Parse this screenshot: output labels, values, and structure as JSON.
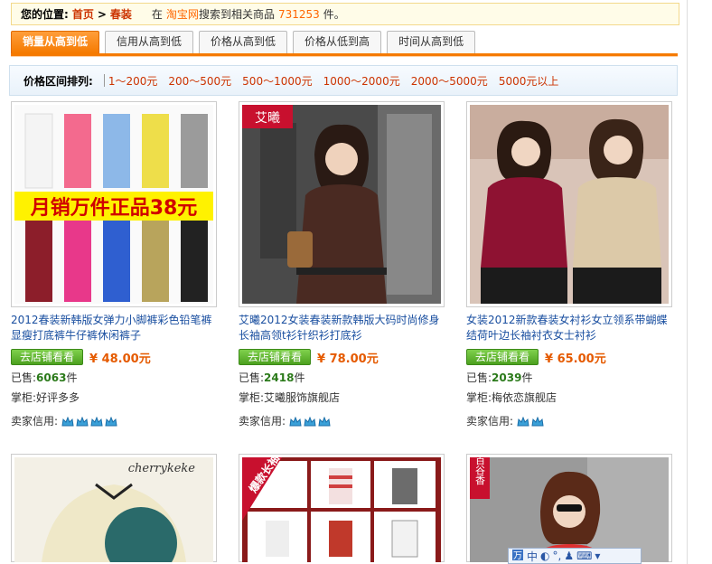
{
  "breadcrumb": {
    "label": "您的位置:",
    "home": "首页",
    "arrow": ">",
    "category": "春装",
    "prefix": "在",
    "site": "淘宝网",
    "middle": "搜索到相关商品",
    "count": "731253",
    "suffix": "件。"
  },
  "tabs": [
    {
      "label": "销量从高到低",
      "active": true
    },
    {
      "label": "信用从高到低",
      "active": false
    },
    {
      "label": "价格从高到低",
      "active": false
    },
    {
      "label": "价格从低到高",
      "active": false
    },
    {
      "label": "时间从高到低",
      "active": false
    }
  ],
  "price_filter": {
    "label": "价格区间排列:",
    "ranges": [
      "1～200元",
      "200～500元",
      "500～1000元",
      "1000～2000元",
      "2000～5000元",
      "5000元以上"
    ]
  },
  "products": [
    {
      "title": "2012春装新韩版女弹力小脚裤彩色铅笔裤显瘦打底裤牛仔裤休闲裤子",
      "button": "去店铺看看",
      "price": "¥ 48.00元",
      "sold_label": "已售:",
      "sold": "6063",
      "sold_unit": "件",
      "keeper_label": "掌柜:",
      "keeper": "好评多多",
      "credit_label": "卖家信用:",
      "image_text": "月销万件正品38元"
    },
    {
      "title": "艾曦2012女装春装新款韩版大码时尚修身长袖高领t衫针织衫打底衫",
      "button": "去店铺看看",
      "price": "¥ 78.00元",
      "sold_label": "已售:",
      "sold": "2418",
      "sold_unit": "件",
      "keeper_label": "掌柜:",
      "keeper": "艾曦服饰旗舰店",
      "credit_label": "卖家信用:",
      "image_text": "艾曦"
    },
    {
      "title": "女装2012新款春装女衬衫女立领系带蝴蝶结荷叶边长袖衬衣女士衬衫",
      "button": "去店铺看看",
      "price": "¥ 65.00元",
      "sold_label": "已售:",
      "sold": "2039",
      "sold_unit": "件",
      "keeper_label": "掌柜:",
      "keeper": "梅依恋旗舰店",
      "credit_label": "卖家信用:",
      "image_text": ""
    }
  ],
  "bottom_cards": [
    {
      "image_text": "cherrykeke"
    },
    {
      "image_text": "爆款长袖"
    },
    {
      "image_text": "百谷香"
    }
  ],
  "ime": {
    "mode": "中"
  },
  "colors": {
    "accent_orange": "#f57a00",
    "link_red": "#cc3300",
    "link_blue": "#1a4fa0",
    "price": "#e55a00",
    "button_green": "#4ca01f"
  }
}
